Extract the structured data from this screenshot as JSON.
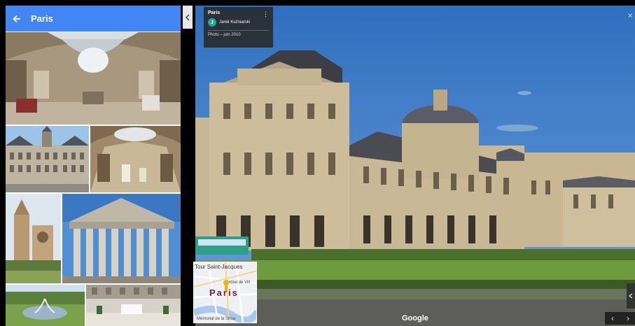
{
  "gallery": {
    "title": "Paris",
    "photos": [
      "Musée d'Orsay nef",
      "Hôtel de Ville",
      "Musée d'Orsay galerie",
      "Notre-Dame",
      "Église de la Madeleine",
      "Jardin fontaine",
      "Cour intérieure"
    ]
  },
  "viewer": {
    "info_card": {
      "title": "Paris",
      "author_initial": "J",
      "author": "Jarek Kuźniarski",
      "date": "Photo – juin 2010"
    },
    "minimap": {
      "label_top": "Tour Saint-Jacques",
      "label_place": "Hôtel de Vill",
      "city": "Paris",
      "label_bottom": "Mémorial de la Shoa"
    },
    "logo": "Google"
  },
  "icons": {
    "back": "arrow-left-icon",
    "collapse": "chevron-left-icon",
    "menu": "more-vert-icon",
    "close": "close-icon",
    "prev": "chevron-left-icon",
    "next": "chevron-right-icon",
    "pin": "map-pin-icon"
  },
  "colors": {
    "header": "#4285f4",
    "avatar": "#26a69a",
    "sky": "#3f7cc7",
    "stone": "#c9b998",
    "grass": "#5f8a3a"
  }
}
